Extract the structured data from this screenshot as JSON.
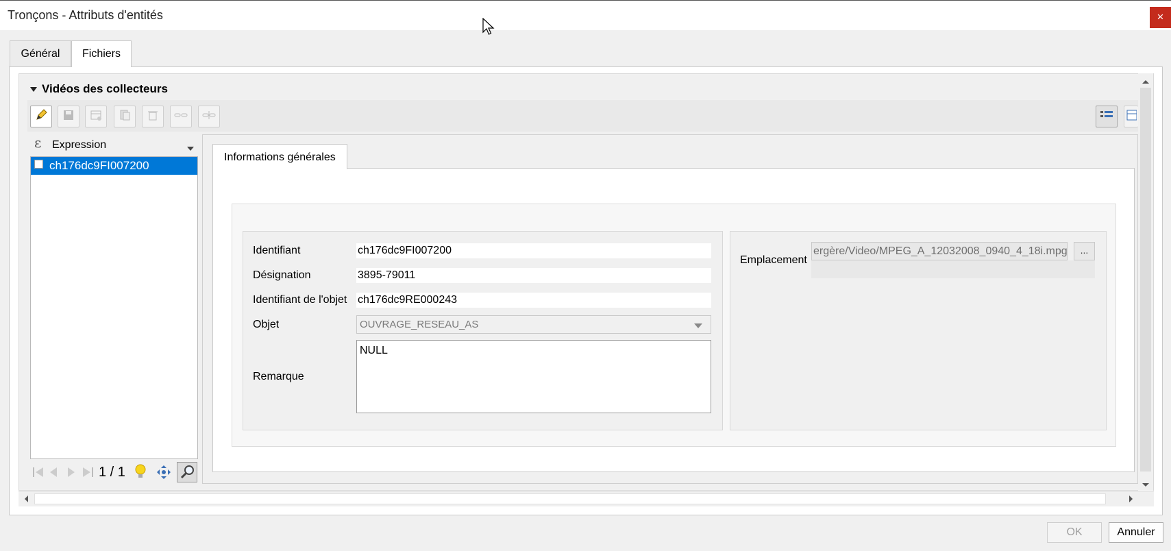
{
  "window": {
    "title": "Tronçons - Attributs d'entités",
    "close_label": "×"
  },
  "tabs": [
    {
      "label": "Général"
    },
    {
      "label": "Fichiers"
    }
  ],
  "section": {
    "title": "Vidéos des collecteurs"
  },
  "toolbar": {
    "buttons": [
      "pencil-edit-icon",
      "save-icon",
      "add-feature-icon",
      "copy-icon",
      "delete-icon",
      "link-icon",
      "unlink-icon"
    ],
    "view_buttons": [
      "form-view-icon",
      "table-view-icon"
    ]
  },
  "list": {
    "expression_label": "Expression",
    "items": [
      {
        "label": "ch176dc9FI007200",
        "selected": true
      }
    ],
    "nav": {
      "page": "1 / 1"
    }
  },
  "form": {
    "tab_label": "Informations générales",
    "fields": {
      "identifiant": {
        "label": "Identifiant",
        "value": "ch176dc9FI007200"
      },
      "designation": {
        "label": "Désignation",
        "value": "3895-79011"
      },
      "identifiant_objet": {
        "label": "Identifiant de l'objet",
        "value": "ch176dc9RE000243"
      },
      "objet": {
        "label": "Objet",
        "value": "OUVRAGE_RESEAU_AS"
      },
      "remarque": {
        "label": "Remarque",
        "value": "NULL"
      },
      "emplacement": {
        "label": "Emplacement",
        "value": "ergère/Video/MPEG_A_12032008_0940_4_18i.mpg",
        "browse_label": "..."
      }
    }
  },
  "buttons": {
    "ok_label": "OK",
    "cancel_label": "Annuler"
  },
  "colors": {
    "selection": "#0078d7",
    "close": "#c42b1c"
  }
}
